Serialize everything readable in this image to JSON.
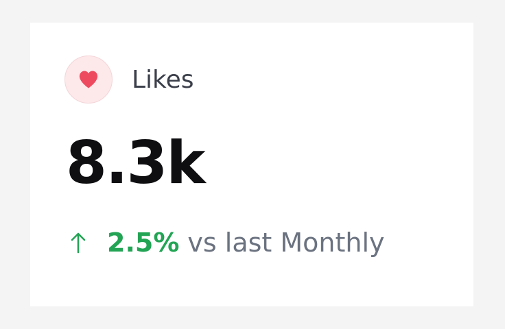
{
  "stat_card": {
    "title": "Likes",
    "icon": "heart-icon",
    "value": "8.3k",
    "change": {
      "direction": "up",
      "icon": "arrow-up-icon",
      "percent": "2.5%",
      "comparison": "vs last Monthly"
    }
  },
  "colors": {
    "heart": "#ee4a5f",
    "icon_bg": "#fde8ea",
    "positive": "#23a455",
    "muted_text": "#6b7280",
    "value_text": "#0f0f12"
  }
}
